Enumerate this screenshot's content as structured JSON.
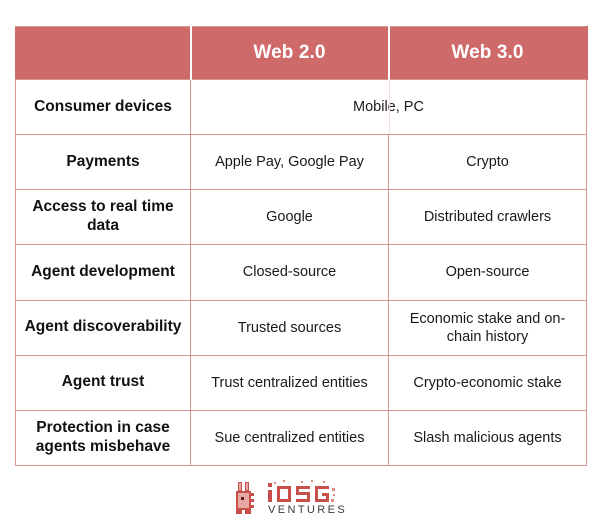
{
  "table": {
    "columns": [
      "",
      "Web 2.0",
      "Web 3.0"
    ],
    "rows": [
      {
        "label": "Consumer devices",
        "merged": true,
        "merged_value": "Mobile, PC"
      },
      {
        "label": "Payments",
        "merged": false,
        "web2": "Apple Pay, Google Pay",
        "web3": "Crypto"
      },
      {
        "label": "Access to real time data",
        "merged": false,
        "web2": "Google",
        "web3": "Distributed crawlers"
      },
      {
        "label": "Agent development",
        "merged": false,
        "web2": "Closed-source",
        "web3": "Open-source"
      },
      {
        "label": "Agent discoverability",
        "merged": false,
        "web2": "Trusted sources",
        "web3": "Economic stake and on-chain history"
      },
      {
        "label": "Agent trust",
        "merged": false,
        "web2": "Trust centralized entities",
        "web3": "Crypto-economic stake"
      },
      {
        "label": "Protection in case agents misbehave",
        "merged": false,
        "web2": "Sue centralized entities",
        "web3": "Slash malicious agents"
      }
    ]
  },
  "logo": {
    "brand": "IOSG",
    "tagline": "VENTURES",
    "mark": "pixel-rabbit-icon"
  },
  "colors": {
    "header_fill": "#ce6a6a",
    "border": "#d9968f",
    "header_text": "#ffffff",
    "body_text": "#1a1a1a",
    "logo_primary": "#c8504a",
    "logo_light": "#e8a8a2",
    "background": "#ffffff"
  }
}
